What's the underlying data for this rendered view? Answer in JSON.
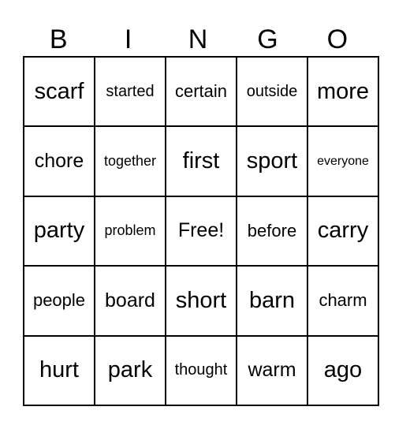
{
  "header": [
    "B",
    "I",
    "N",
    "G",
    "O"
  ],
  "rows": [
    [
      "scarf",
      "started",
      "certain",
      "outside",
      "more"
    ],
    [
      "chore",
      "together",
      "first",
      "sport",
      "everyone"
    ],
    [
      "party",
      "problem",
      "Free!",
      "before",
      "carry"
    ],
    [
      "people",
      "board",
      "short",
      "barn",
      "charm"
    ],
    [
      "hurt",
      "park",
      "thought",
      "warm",
      "ago"
    ]
  ]
}
